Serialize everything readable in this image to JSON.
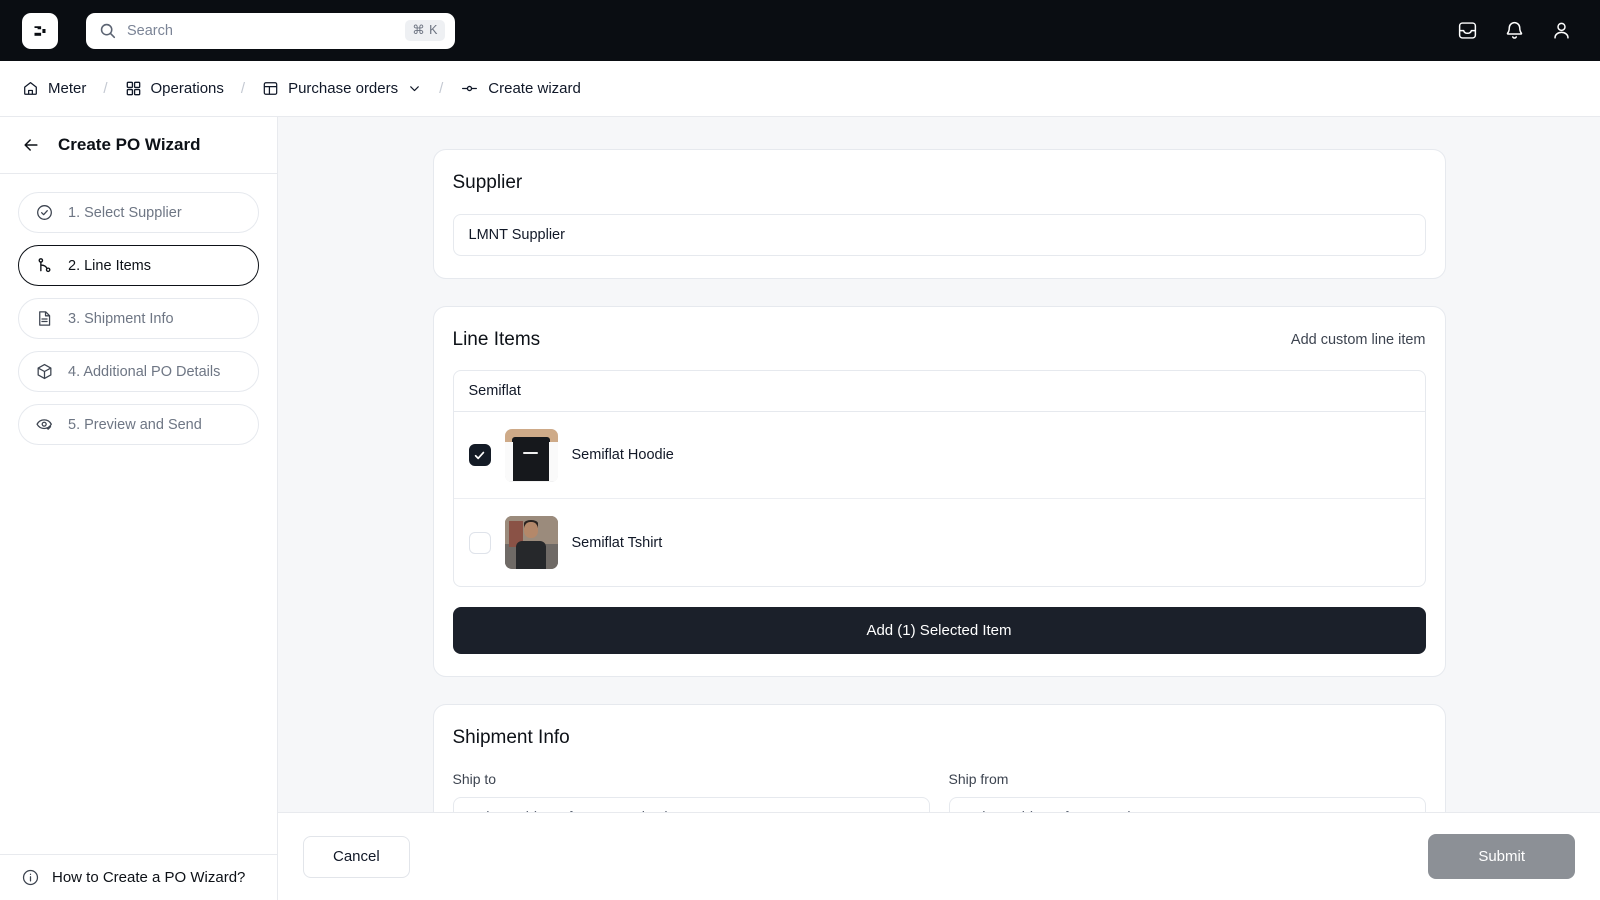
{
  "topbar": {
    "logo_icon": "app-logo-icon",
    "search_placeholder": "Search",
    "search_value": "",
    "search_icon": "search-icon",
    "shortcut": "⌘ K",
    "inbox_icon": "inbox-icon",
    "bell_icon": "bell-icon",
    "user_icon": "user-icon",
    "background": "#0a0d12"
  },
  "breadcrumb": {
    "items": [
      {
        "label": "Meter",
        "icon": "home-icon"
      },
      {
        "label": "Operations",
        "icon": "grid-icon"
      },
      {
        "label": "Purchase orders",
        "icon": "table-icon",
        "has_chevron": true
      },
      {
        "label": "Create wizard",
        "icon": "node-icon"
      }
    ],
    "separator": "/"
  },
  "sidebar": {
    "back_icon": "arrow-left-icon",
    "title": "Create PO Wizard",
    "steps": [
      {
        "label": "1. Select Supplier",
        "icon": "circle-check-icon",
        "active": false
      },
      {
        "label": "2. Line Items",
        "icon": "git-branch-icon",
        "active": true
      },
      {
        "label": "3. Shipment Info",
        "icon": "document-icon",
        "active": false
      },
      {
        "label": "4. Additional PO Details",
        "icon": "box-icon",
        "active": false
      },
      {
        "label": "5. Preview and Send",
        "icon": "eye-check-icon",
        "active": false
      }
    ],
    "footer": {
      "label": "How to Create a PO Wizard?",
      "icon": "info-icon"
    }
  },
  "main": {
    "supplier": {
      "title": "Supplier",
      "value": "LMNT Supplier"
    },
    "line_items": {
      "title": "Line Items",
      "add_custom_label": "Add custom line item",
      "group_label": "Semiflat",
      "items": [
        {
          "name": "Semiflat Hoodie",
          "checked": true,
          "thumb": "hoodie-thumbnail"
        },
        {
          "name": "Semiflat Tshirt",
          "checked": false,
          "thumb": "tshirt-thumbnail"
        }
      ],
      "add_button_label": "Add (1) Selected Item",
      "selected_count": 1
    },
    "shipment_info": {
      "title": "Shipment Info",
      "ship_to": {
        "label": "Ship to",
        "value": "Select address from Organization"
      },
      "ship_from": {
        "label": "Ship from",
        "value": "Select address from Vendor"
      }
    }
  },
  "footer_bar": {
    "cancel_label": "Cancel",
    "submit_label": "Submit",
    "submit_disabled": true,
    "submit_color": "#8c9096"
  }
}
